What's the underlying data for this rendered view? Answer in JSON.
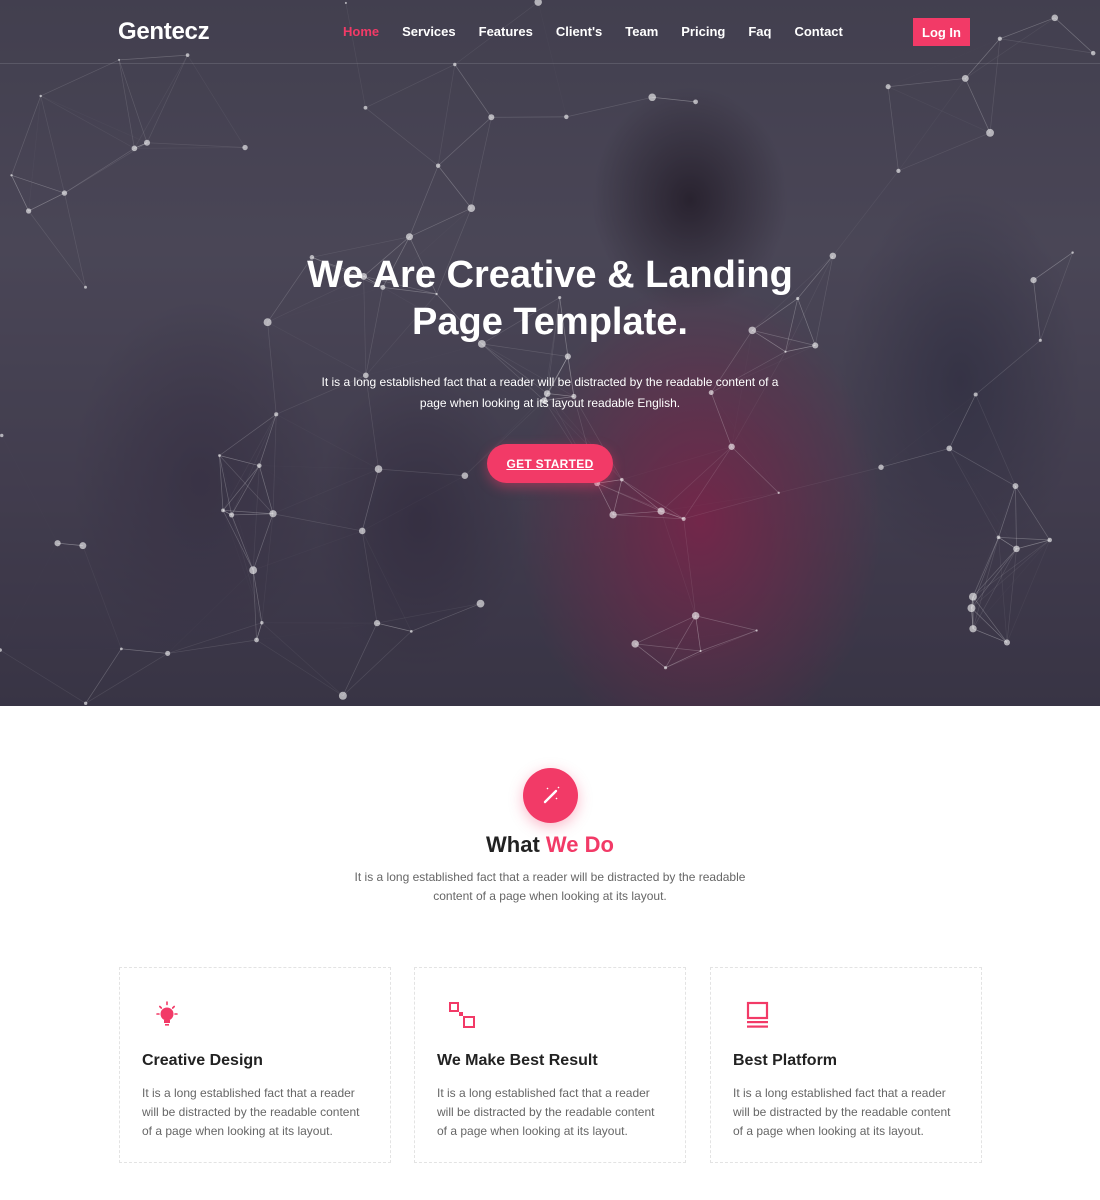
{
  "brand": "Gentecz",
  "nav": {
    "items": [
      "Home",
      "Services",
      "Features",
      "Client's",
      "Team",
      "Pricing",
      "Faq",
      "Contact"
    ],
    "active": "Home",
    "login_label": "Log In"
  },
  "hero": {
    "title": "We Are Creative & Landing Page Template.",
    "text": "It is a long established fact that a reader will be distracted by the readable content of a page when looking at its layout readable English.",
    "cta_label": "GET STARTED"
  },
  "what_we_do": {
    "icon": "magic-wand-icon",
    "title_main": "What",
    "title_accent": "We Do",
    "description": "It is a long established fact that a reader will be distracted by the readable content of a page when looking at its layout.",
    "cards": [
      {
        "icon": "lightbulb-icon",
        "title": "Creative Design",
        "text": "It is a long established fact that a reader will be distracted by the readable content of a page when looking at its layout."
      },
      {
        "icon": "connected-squares-icon",
        "title": "We Make Best Result",
        "text": "It is a long established fact that a reader will be distracted by the readable content of a page when looking at its layout."
      },
      {
        "icon": "monitor-icon",
        "title": "Best Platform",
        "text": "It is a long established fact that a reader will be distracted by the readable content of a page when looking at its layout."
      }
    ]
  },
  "colors": {
    "accent": "#f23a67",
    "heading": "#222222",
    "body_text": "#666666"
  }
}
